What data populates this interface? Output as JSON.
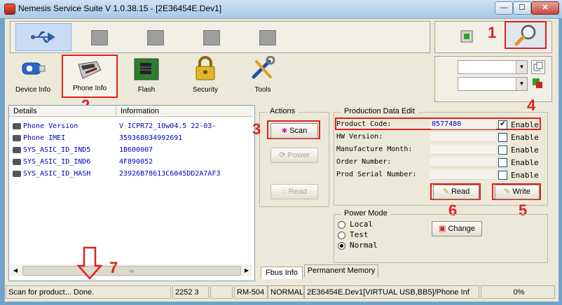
{
  "window": {
    "title": "Nemesis Service Suite V 1.0.38.15 - [2E36454E.Dev1]",
    "minimize": "—",
    "maximize": "☐",
    "close": "✕"
  },
  "nav": {
    "items": [
      {
        "label": "Device Info",
        "icon": "usb-stick-icon"
      },
      {
        "label": "Phone Info",
        "icon": "phone-icon"
      },
      {
        "label": "Flash",
        "icon": "chip-icon"
      },
      {
        "label": "Security",
        "icon": "padlock-icon"
      },
      {
        "label": "Tools",
        "icon": "tools-icon"
      }
    ]
  },
  "info_table": {
    "headers": [
      "Details",
      "Information"
    ],
    "rows": [
      {
        "detail": "Phone Version",
        "info": "V ICPR72_10w04.5 22-03-"
      },
      {
        "detail": "Phone IMEI",
        "info": "359368034992691"
      },
      {
        "detail": "SYS_ASIC_ID_IND5",
        "info": "1B600007"
      },
      {
        "detail": "SYS_ASIC_ID_IND6",
        "info": "4F890052"
      },
      {
        "detail": "SYS_ASIC_ID_HASH",
        "info": "23926B78613C6045DD2A7AF3"
      }
    ],
    "scroll_thumb": "‹›"
  },
  "actions": {
    "title": "Actions",
    "scan": "Scan",
    "power": "Power",
    "read": "Read"
  },
  "production": {
    "title": "Production Data Edit",
    "fields": [
      {
        "label": "Product Code:",
        "value": "0577480",
        "enable": true
      },
      {
        "label": "HW Version:",
        "value": "",
        "enable": false
      },
      {
        "label": "Manufacture Month:",
        "value": "",
        "enable": false
      },
      {
        "label": "Order Number:",
        "value": "",
        "enable": false
      },
      {
        "label": "Prod Serial Number:",
        "value": "",
        "enable": false
      }
    ],
    "enable_label": "Enable",
    "read_button": "Read",
    "write_button": "Write"
  },
  "power_mode": {
    "title": "Power Mode",
    "options": [
      "Local",
      "Test",
      "Normal"
    ],
    "selected": "Normal",
    "change_button": "Change"
  },
  "tabs": [
    "Fbus Info",
    "Permanent Memory"
  ],
  "status": {
    "message": "Scan for product... Done.",
    "c2": "2252 3",
    "c3": "",
    "model": "RM-504",
    "mode": "NORMAL",
    "device": "2E36454E.Dev1[VIRTUAL USB,BB5]/Phone Inf",
    "progress": "0%"
  },
  "annotations": [
    "1",
    "2",
    "3",
    "4",
    "5",
    "6",
    "7"
  ],
  "colors": {
    "annotation": "#e02020",
    "value_text": "#0000c0"
  }
}
